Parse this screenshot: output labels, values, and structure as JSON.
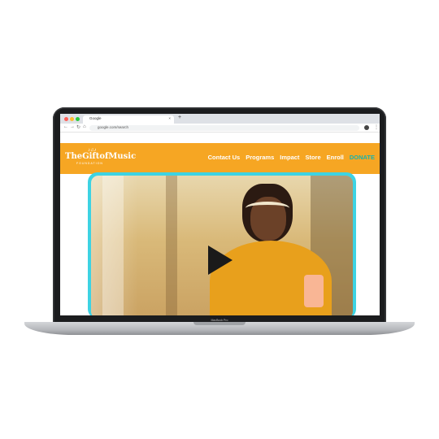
{
  "device": {
    "model_label": "MacBook Pro"
  },
  "browser": {
    "tab_title": "Google",
    "tab_close": "×",
    "new_tab": "+",
    "url": "google.com/search",
    "nav_back": "←",
    "nav_forward": "→",
    "nav_reload": "↻",
    "nav_home": "⌂",
    "menu": "⋮"
  },
  "site": {
    "logo_main": "TheGiftofMusic",
    "logo_sub": "FOUNDATION",
    "logo_notes": "♪♫♪",
    "nav": [
      "Contact Us",
      "Programs",
      "Impact",
      "Store",
      "Enroll",
      "DONATE"
    ]
  },
  "colors": {
    "brand_orange": "#f6a623",
    "donate_teal": "#18b3ad",
    "video_border": "#3dd3e3"
  },
  "video": {
    "play_icon": "play-icon"
  }
}
